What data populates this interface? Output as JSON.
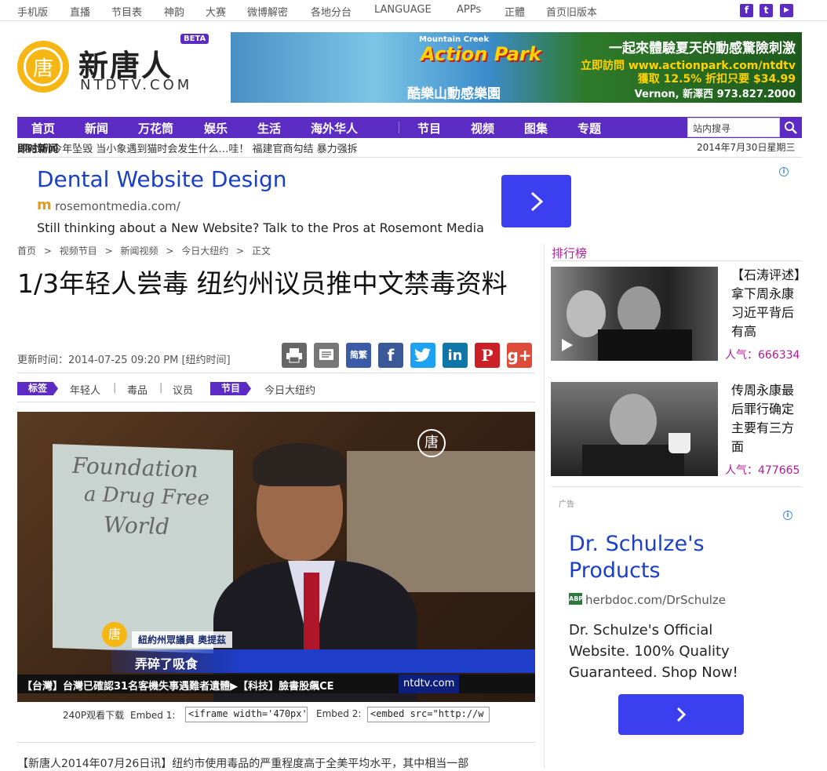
{
  "topbar": {
    "links": [
      "手机版",
      "直播",
      "节目表",
      "神韵",
      "大赛",
      "微博解密",
      "各地分台",
      "LANGUAGE",
      "APPs",
      "正體",
      "首页旧版本"
    ],
    "social": [
      "f",
      "t",
      "▶"
    ]
  },
  "logo": {
    "cn": "新唐人",
    "en": "NTDTV.COM",
    "badge": "BETA",
    "seal": "唐"
  },
  "banner": {
    "small": "Mountain Creek",
    "brand": "Action Park",
    "sub": "酷樂山動感樂園",
    "line1": "一起來體驗夏天的動感驚險刺激",
    "line2": "立即訪問 www.actionpark.com/ntdtv",
    "line3": "獲取 12.5% 折扣只要 $34.99",
    "line4": "Vernon, 新澤西 973.827.2000"
  },
  "nav": {
    "items": [
      "首页",
      "新闻",
      "万花筒",
      "娱乐",
      "生活",
      "海外华人",
      "节目",
      "视频",
      "图集",
      "专题"
    ],
    "search_placeholder": "站内搜寻"
  },
  "ticker": {
    "label": "即时新闻",
    "items": [
      "‹格战机今年坠毁",
      "当小象遇到猫时会发生什么…哇！",
      "福建官商勾结 暴力强拆"
    ],
    "date": "2014年7月30日星期三"
  },
  "ad1": {
    "title": "Dental Website Design",
    "url": "rosemontmedia.com/",
    "desc": "Still thinking about a New Website? Talk to the Pros at Rosemont Media",
    "info": "i"
  },
  "breadcrumb": [
    "首页",
    "视频节目",
    "新闻视频",
    "今日大纽约",
    "正文"
  ],
  "article": {
    "title": "1/3年轻人尝毒 纽约州议员推中文禁毒资料",
    "updated_label": "更新时间：",
    "updated": "2014-07-25 09:20 PM [纽约时间]",
    "tags_label": "标签",
    "tags": [
      "年轻人",
      "毒品",
      "议员"
    ],
    "program_label": "节目",
    "program": "今日大纽约",
    "share_icons": [
      "print",
      "comment",
      "简繁",
      "facebook",
      "twitter",
      "linkedin",
      "pinterest",
      "google-plus"
    ],
    "share_glyphs": {
      "jianfan": "简繁",
      "facebook": "f",
      "linkedin": "in",
      "pinterest": "P",
      "gplus": "g+"
    },
    "body_start": "【新唐人2014年07月26日讯】纽约市使用毒品的严重程度高于全美平均水平，其中相当一部"
  },
  "video": {
    "poster_line1": "Foundation",
    "poster_line2": "a Drug Free",
    "poster_line3": "World",
    "name_caption": "紐約州眾議員  奧提茲",
    "main_caption": "弄碎了吸食",
    "ticker": "【台灣】台灣已確認31名客機失事遇難者遺體▶【科技】臉書股飆CE",
    "ticker_logo": "ntdtv.com",
    "embed_label": "240P观看下载",
    "embed1_label": "Embed 1:",
    "embed1_value": "<iframe width='470px'",
    "embed2_label": "Embed 2:",
    "embed2_value": "<embed src=\"http://w"
  },
  "sidebar": {
    "rank_title": "排行榜",
    "items": [
      {
        "title": "【石涛评述】拿下周永康 习近平背后有高",
        "pop": "人气：666334"
      },
      {
        "title": "传周永康最后罪行确定主要有三方面",
        "pop": "人气：477665"
      }
    ],
    "ad_label": "广告",
    "ad": {
      "title": "Dr. Schulze's Products",
      "icon": "ABP",
      "url": "herbdoc.com/DrSchulze",
      "desc": "Dr. Schulze's Official Website. 100% Quality Guaranteed. Shop Now!"
    }
  }
}
